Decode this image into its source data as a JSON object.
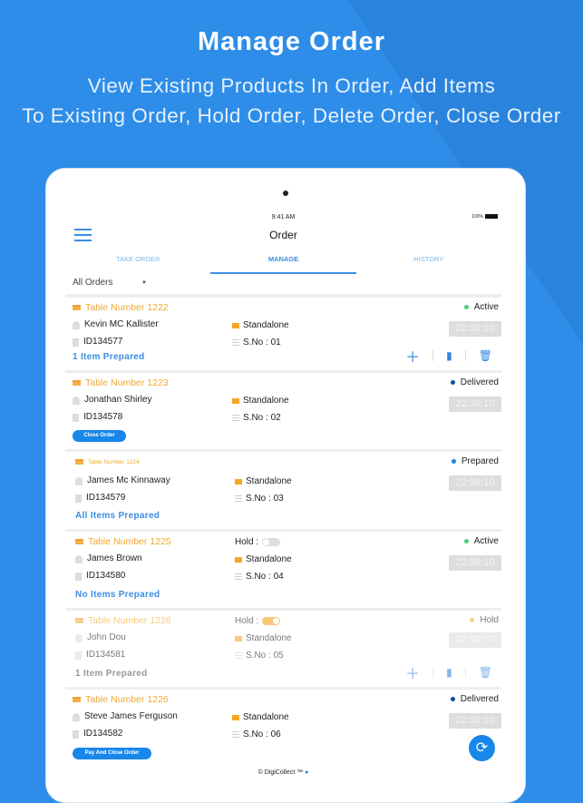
{
  "hero": {
    "title": "Manage Order",
    "subtitle_line1": "View Existing Products In Order, Add Items",
    "subtitle_line2": "To Existing Order, Hold Order, Delete Order, Close Order"
  },
  "device": {
    "time": "9:41 AM",
    "battery": "100%"
  },
  "nav": {
    "title": "Order",
    "menu_icon": "hamburger-icon"
  },
  "tabs": [
    {
      "label": "TAKE ORDER"
    },
    {
      "label": "MANAGE",
      "active": true
    },
    {
      "label": "HISTORY"
    }
  ],
  "filter": {
    "value": "All Orders"
  },
  "colors": {
    "accent": "#1787ea",
    "table": "#f0a830",
    "active": "#4cd07a",
    "delivered": "#0d4ea6",
    "prepared": "#1787ea",
    "hold": "#f5b04a"
  },
  "orders": [
    {
      "table": "Table Number 1222",
      "customer": "Kevin MC Kallister",
      "id": "ID134577",
      "type": "Standalone",
      "sno": "S.No : 01",
      "status": "Active",
      "status_color": "#4cd07a",
      "time": "22:30:10",
      "prepared": "1 Item Prepared",
      "actions": true
    },
    {
      "table": "Table Number 1223",
      "customer": "Jonathan Shirley",
      "id": "ID134578",
      "type": "Standalone",
      "sno": "S.No : 02",
      "status": "Delivered",
      "status_color": "#0d4ea6",
      "time": "22:30:10",
      "button": "Close Order"
    },
    {
      "table": "Table Number 1224",
      "customer": "James Mc Kinnaway",
      "id": "ID134579",
      "type": "Standalone",
      "sno": "S.No : 03",
      "status": "Prepared",
      "status_color": "#1787ea",
      "time": "22:30:10",
      "prepared": "All Items Prepared"
    },
    {
      "table": "Table Number 1225",
      "hold_label": "Hold :",
      "hold_on": false,
      "customer": "James Brown",
      "id": "ID134580",
      "type": "Standalone",
      "sno": "S.No : 04",
      "status": "Active",
      "status_color": "#4cd07a",
      "time": "22:30:10",
      "prepared": "No Items Prepared"
    },
    {
      "table": "Table Number 1226",
      "hold_label": "Hold :",
      "hold_on": true,
      "customer": "John Dou",
      "id": "ID134581",
      "type": "Standalone",
      "sno": "S.No : 05",
      "status": "Hold",
      "status_color": "#f5b04a",
      "time": "22:30:10",
      "prepared": "1 Item Prepared",
      "actions": true
    },
    {
      "table": "Table Number 1226",
      "customer": "Steve James Ferguson",
      "id": "ID134582",
      "type": "Standalone",
      "sno": "S.No : 06",
      "status": "Delivered",
      "status_color": "#0d4ea6",
      "time": "22:30:10",
      "button": "Pay And Close Order"
    }
  ],
  "footer": {
    "text": "© DigiCollect ™"
  }
}
